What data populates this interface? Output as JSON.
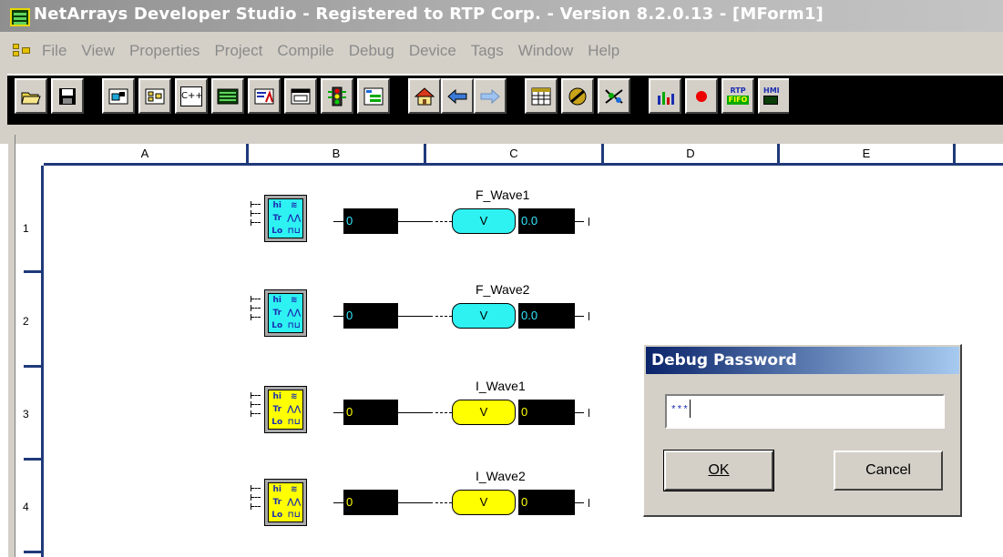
{
  "window": {
    "title": "NetArrays Developer Studio - Registered to RTP Corp. - Version 8.2.0.13 - [MForm1]"
  },
  "menu": {
    "items": [
      "File",
      "View",
      "Properties",
      "Project",
      "Compile",
      "Debug",
      "Device",
      "Tags",
      "Window",
      "Help"
    ]
  },
  "toolbar": {
    "buttons": [
      {
        "icon": "open-folder-icon"
      },
      {
        "icon": "save-disk-icon"
      },
      {
        "icon": "function-block-icon"
      },
      {
        "icon": "network-block-icon"
      },
      {
        "icon": "cpp-block-icon"
      },
      {
        "icon": "memory-chip-icon"
      },
      {
        "icon": "text-edit-icon"
      },
      {
        "icon": "form-window-icon"
      },
      {
        "icon": "traffic-light-icon"
      },
      {
        "icon": "ladder-list-icon"
      },
      {
        "icon": "home-icon"
      },
      {
        "icon": "arrow-left-icon"
      },
      {
        "icon": "arrow-right-icon"
      },
      {
        "icon": "table-icon"
      },
      {
        "icon": "no-entry-icon"
      },
      {
        "icon": "io-map-icon"
      },
      {
        "icon": "bar-chart-icon"
      },
      {
        "icon": "red-dot-icon"
      },
      {
        "icon": "rtp-fifo-icon"
      },
      {
        "icon": "hmi-icon"
      }
    ],
    "labels": {
      "cpp": "C++",
      "rtp": "RTP",
      "fifo": "FIFO",
      "hmi": "HMI"
    }
  },
  "grid": {
    "columns": [
      "A",
      "B",
      "C",
      "D",
      "E"
    ],
    "rows": [
      "1",
      "2",
      "3",
      "4"
    ]
  },
  "generator": {
    "hi": "hi",
    "tr": "Tr",
    "lo": "Lo"
  },
  "blocks": [
    {
      "generator_value": "0",
      "tag_name": "F_Wave1",
      "tag_type": "V",
      "tag_value": "0.0",
      "color": "#2ef2f2"
    },
    {
      "generator_value": "0",
      "tag_name": "F_Wave2",
      "tag_type": "V",
      "tag_value": "0.0",
      "color": "#2ef2f2"
    },
    {
      "generator_value": "0",
      "tag_name": "I_Wave1",
      "tag_type": "V",
      "tag_value": "0",
      "color": "#ffff00"
    },
    {
      "generator_value": "0",
      "tag_name": "I_Wave2",
      "tag_type": "V",
      "tag_value": "0",
      "color": "#ffff00"
    }
  ],
  "dialog": {
    "title": "Debug Password",
    "password_value": "***",
    "ok_label": "OK",
    "cancel_label": "Cancel"
  }
}
